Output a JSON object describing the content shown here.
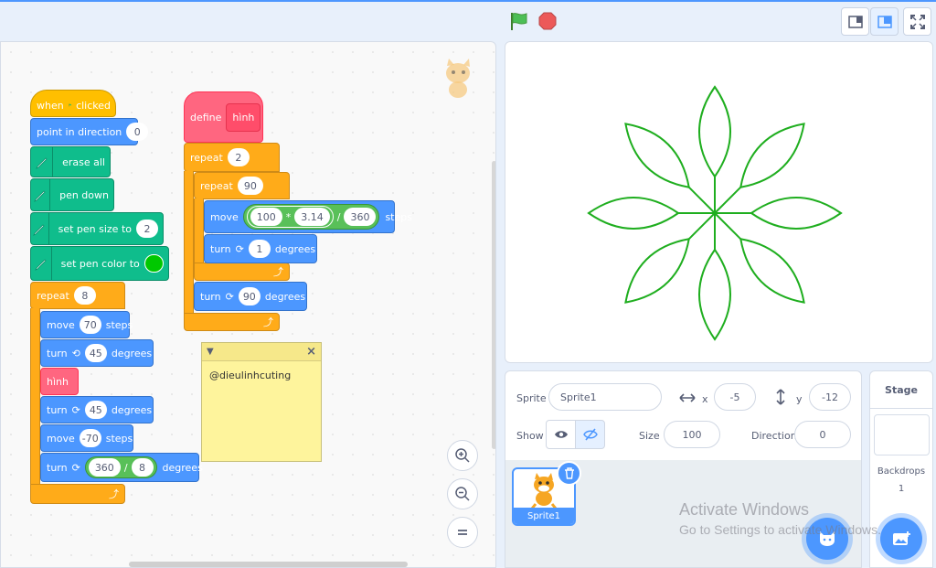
{
  "header": {
    "flag_icon": "green-flag-icon",
    "stop_icon": "stop-sign-icon"
  },
  "blocks": {
    "when": "when",
    "clicked": "clicked",
    "point_in_direction": "point in direction",
    "direction_value": "0",
    "erase_all": "erase all",
    "pen_down": "pen down",
    "set_pen_size": "set pen size to",
    "pen_size_value": "2",
    "set_pen_color": "set pen color to",
    "pen_color": "#00c800",
    "repeat": "repeat",
    "repeat_outer_value": "8",
    "move": "move",
    "steps": "steps",
    "move_value_1": "70",
    "turn": "turn",
    "degrees": "degrees",
    "turn_left_value": "45",
    "hinh_call": "hình",
    "turn_right_value_1": "45",
    "move_value_2": "-70",
    "div_a": "360",
    "div_op": "/",
    "div_b": "8",
    "define": "define",
    "define_name": "hình",
    "repeat_def_value": "2",
    "repeat_inner_value": "90",
    "mul_a": "100",
    "mul_op": "*",
    "mul_b": "3.14",
    "div2_op": "/",
    "div2_b": "360",
    "turn_inner_value": "1",
    "turn_def_value": "90"
  },
  "note": {
    "text": "@dieulinhcuting"
  },
  "sprite_info": {
    "sprite_label": "Sprite",
    "sprite_name": "Sprite1",
    "x_label": "x",
    "x_value": "-5",
    "y_label": "y",
    "y_value": "-12",
    "show_label": "Show",
    "size_label": "Size",
    "size_value": "100",
    "direction_label": "Direction",
    "direction_value": "0"
  },
  "sprite_list": {
    "sprite1_name": "Sprite1"
  },
  "stage_panel": {
    "title": "Stage",
    "backdrops_label": "Backdrops",
    "backdrops_count": "1"
  },
  "watermark": {
    "line1": "Activate Windows",
    "line2": "Go to Settings to activate Windows."
  },
  "colors": {
    "motion": "#4c97ff",
    "control": "#ffab19",
    "events": "#ffbf00",
    "pen": "#0fbd8c",
    "myblocks": "#ff6680",
    "operators": "#59c059",
    "flower_stroke": "#1fae1f"
  }
}
